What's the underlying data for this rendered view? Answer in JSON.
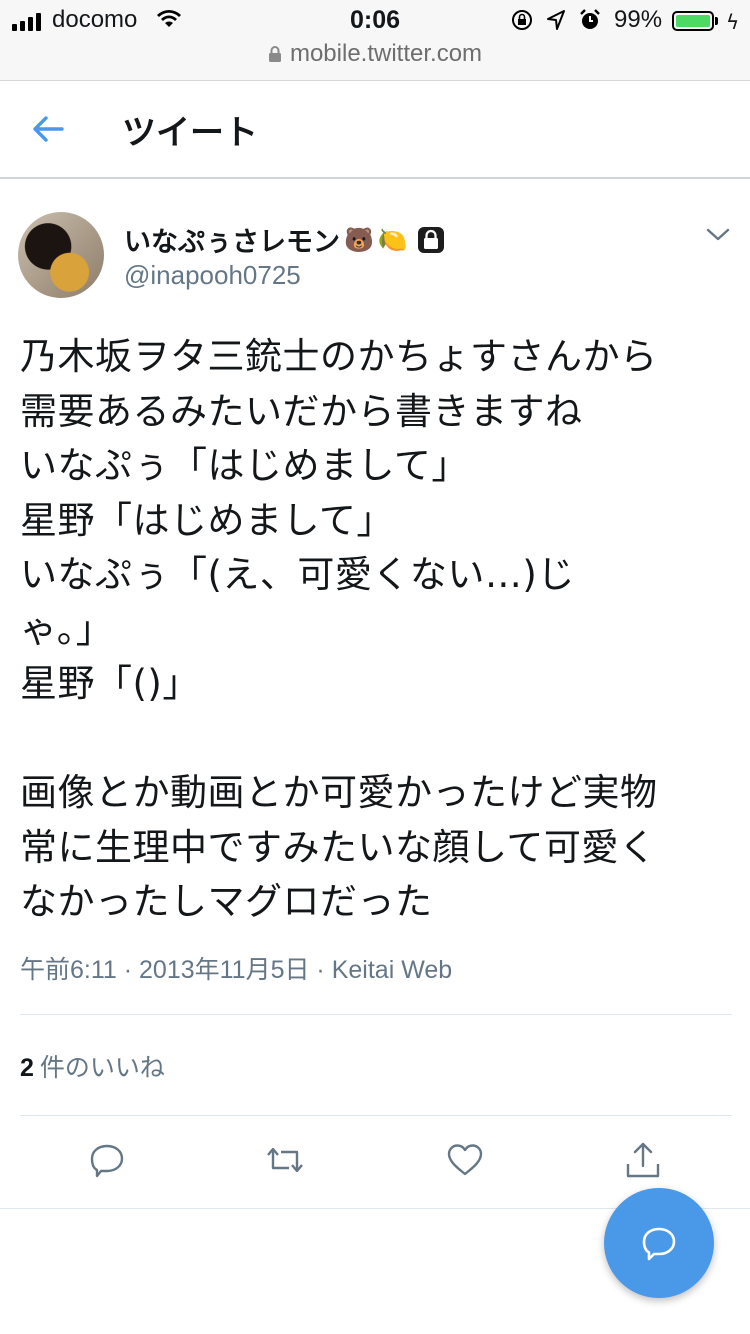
{
  "status_bar": {
    "carrier": "docomo",
    "time": "0:06",
    "battery_percent": "99%",
    "battery_level": 0.99,
    "url": "mobile.twitter.com"
  },
  "header": {
    "title": "ツイート"
  },
  "tweet": {
    "display_name": "いなぷぅさレモン",
    "name_emojis": [
      "🐻",
      "🍋"
    ],
    "handle": "@inapooh0725",
    "text": "乃木坂ヲタ三銃士のかちょすさんから\n需要あるみたいだから書きますね\nいなぷぅ「はじめまして」\n星野「はじめまして」\nいなぷぅ「(え、可愛くない…)じ\nゃ。」\n星野「()」\n\n画像とか動画とか可愛かったけど実物\n常に生理中ですみたいな顔して可愛く\nなかったしマグロだった",
    "timestamp": "午前6:11 · 2013年11月5日 · Keitai Web",
    "like_count": "2",
    "like_label": "件のいいね"
  },
  "icons": {
    "back": "back-arrow-icon",
    "caret": "chevron-down-icon",
    "reply": "reply-icon",
    "retweet": "retweet-icon",
    "like": "heart-icon",
    "share": "share-icon",
    "compose": "compose-icon",
    "protected": "lock-icon"
  },
  "colors": {
    "accent": "#4a99e9",
    "secondary_text": "#657786",
    "battery": "#4cd964"
  }
}
